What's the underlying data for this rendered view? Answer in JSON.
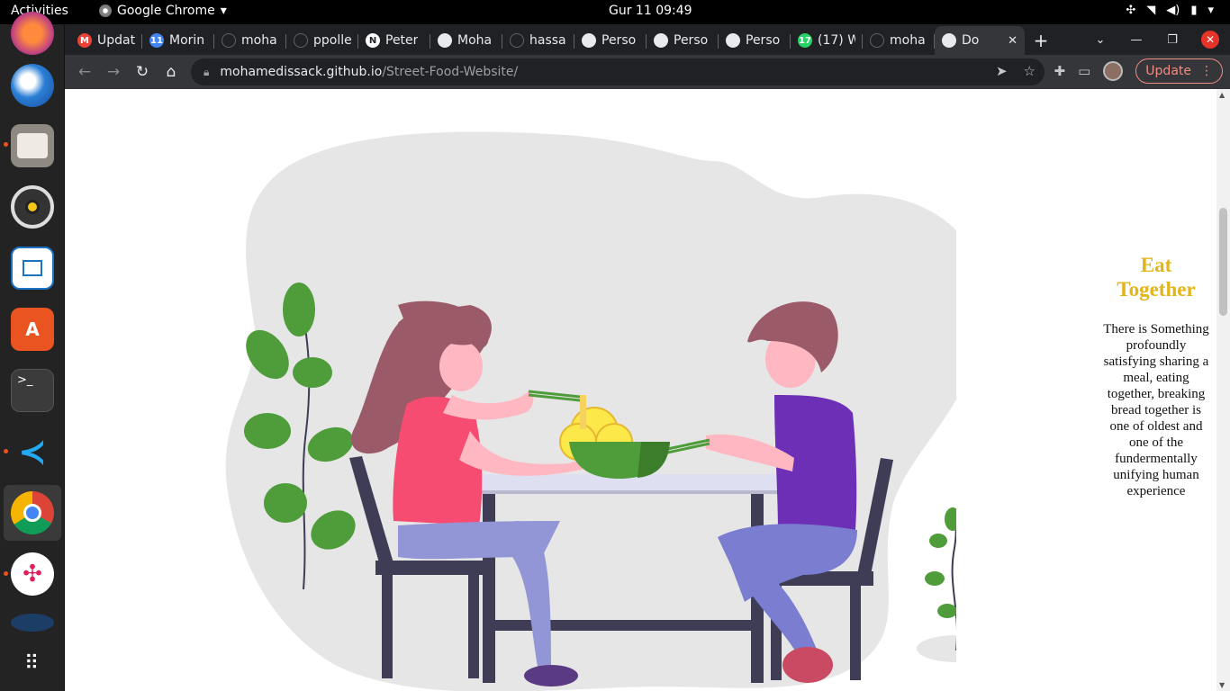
{
  "topbar": {
    "activities": "Activities",
    "app_name": "Google Chrome",
    "clock": "Gur 11  09:49"
  },
  "tabs": [
    {
      "label": "Updat",
      "icon": "gmail-icon",
      "color": "#ea4335",
      "glyph": "M"
    },
    {
      "label": "Morin",
      "icon": "calendar-icon",
      "color": "#4285f4",
      "glyph": "11"
    },
    {
      "label": "moha",
      "icon": "github-icon",
      "color": "#202124",
      "glyph": ""
    },
    {
      "label": "ppolle",
      "icon": "github-icon",
      "color": "#202124",
      "glyph": ""
    },
    {
      "label": "Peter",
      "icon": "notion-icon",
      "color": "#ffffff",
      "glyph": "N"
    },
    {
      "label": "Moha",
      "icon": "globe-icon",
      "color": "#e8eaed",
      "glyph": ""
    },
    {
      "label": "hassa",
      "icon": "github-icon",
      "color": "#202124",
      "glyph": ""
    },
    {
      "label": "Perso",
      "icon": "globe-icon",
      "color": "#e8eaed",
      "glyph": ""
    },
    {
      "label": "Perso",
      "icon": "globe-icon",
      "color": "#e8eaed",
      "glyph": ""
    },
    {
      "label": "Perso",
      "icon": "globe-icon",
      "color": "#e8eaed",
      "glyph": ""
    },
    {
      "label": "(17) W",
      "icon": "whatsapp-icon",
      "color": "#25d366",
      "glyph": "17"
    },
    {
      "label": "moha",
      "icon": "github-icon",
      "color": "#202124",
      "glyph": ""
    }
  ],
  "active_tab": {
    "label": "Do",
    "icon": "globe-icon"
  },
  "toolbar": {
    "url_host": "mohamedissack.github.io",
    "url_path": "/Street-Food-Website/",
    "update_label": "Update"
  },
  "page": {
    "title": "Eat Together",
    "body": "There is Something profoundly satisfying sharing a meal, eating together, breaking bread together is one of oldest and one of the fundermentally unifying human experience"
  },
  "colors": {
    "accent_title": "#e2b51a",
    "blob": "#e6e6e6",
    "woman_shirt": "#f64c71",
    "man_shirt": "#6c2fb5",
    "plant": "#4f9d3a"
  }
}
